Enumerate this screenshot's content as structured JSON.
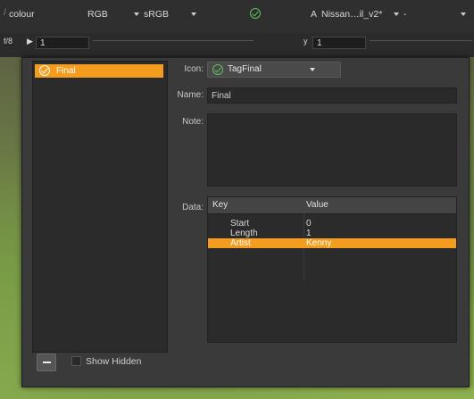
{
  "toolbar": {
    "colour_label": "colour",
    "colorspace": "RGB",
    "display": "sRGB",
    "ident_prefix": "A",
    "input_name": "Nissan…il_v2*",
    "compare_value": "-"
  },
  "slider_row": {
    "fstop_label": "f/8",
    "fstop_value": "1",
    "y_label": "y",
    "y_value": "1"
  },
  "dialog": {
    "tags": [
      {
        "label": "Final",
        "icon": "check-circle-icon",
        "selected": true
      }
    ],
    "icon_label": "Icon:",
    "icon_value": "TagFinal",
    "name_label": "Name:",
    "name_value": "Final",
    "note_label": "Note:",
    "note_value": "",
    "data_label": "Data:",
    "table": {
      "headers": [
        "Key",
        "Value"
      ],
      "rows": [
        {
          "key": "Start",
          "value": "0"
        },
        {
          "key": "Length",
          "value": "1"
        },
        {
          "key": "Artist",
          "value": "Kenny",
          "selected": true
        }
      ]
    },
    "show_hidden_label": "Show Hidden"
  },
  "colors": {
    "accent": "#f39c1d",
    "check_green": "#5cc15c"
  }
}
